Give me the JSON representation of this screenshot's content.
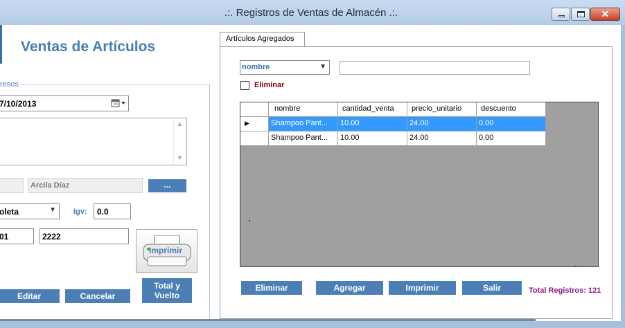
{
  "window": {
    "title": ".:. Registros de Ventas de Almacén .:."
  },
  "left": {
    "heading": "Ventas de Artículos",
    "group_label": "resos",
    "date_value": "7/10/2013",
    "client_name": "Arcila Díaz",
    "dots_label": "...",
    "doc_type": "oleta",
    "igv_label": "Igv:",
    "igv_value": "0.0",
    "serie_value": "01",
    "numero_value": "2222",
    "print_label": "Imprimir",
    "btn_editar": "Editar",
    "btn_cancelar": "Cancelar",
    "btn_total_line1": "Total y",
    "btn_total_line2": "Vuelto"
  },
  "tab": {
    "label": "Artículos Agregados",
    "filter_field": "nombre",
    "search_value": "",
    "delete_checkbox_label": "Eliminar",
    "delete_checked": false
  },
  "grid": {
    "columns": [
      "nombre",
      "cantidad_venta",
      "precio_unitario",
      "descuento"
    ],
    "rows": [
      {
        "nombre": "Shampoo Pant...",
        "cantidad_venta": "10.00",
        "precio_unitario": "24.00",
        "descuento": "0.00",
        "selected": true
      },
      {
        "nombre": "Shampoo Pant...",
        "cantidad_venta": "10.00",
        "precio_unitario": "24.00",
        "descuento": "0.00",
        "selected": false
      }
    ]
  },
  "actions": {
    "eliminar": "Eliminar",
    "agregar": "Agregar",
    "imprimir": "Imprimir",
    "salir": "Salir",
    "total_registros": "Total Registros: 121"
  },
  "icons": {
    "calendar": "calendar-icon",
    "printer": "printer-icon",
    "row_pointer": "row-pointer-icon"
  },
  "colors": {
    "accent_blue": "#4b7fb5",
    "heading_blue": "#4a7eb3",
    "selection_blue": "#3399ff",
    "eliminar_red": "#8b0000",
    "total_purple": "#8b1a8b"
  }
}
